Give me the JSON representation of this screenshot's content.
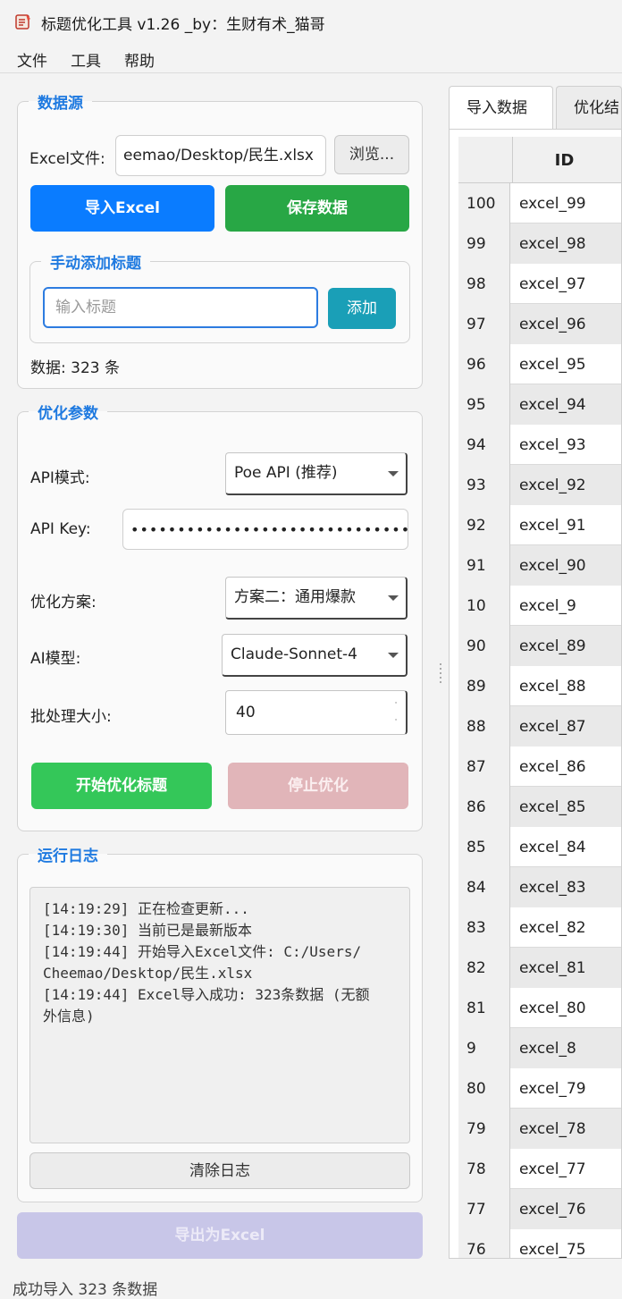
{
  "window": {
    "title": "标题优化工具 v1.26 _by：生财有术_猫哥"
  },
  "menu": {
    "items": [
      "文件",
      "工具",
      "帮助"
    ]
  },
  "data_source": {
    "legend": "数据源",
    "excel_label": "Excel文件:",
    "excel_path": "eemao/Desktop/民生.xlsx",
    "browse_label": "浏览...",
    "import_label": "导入Excel",
    "save_label": "保存数据",
    "manual_legend": "手动添加标题",
    "manual_placeholder": "输入标题",
    "add_label": "添加",
    "count_text": "数据: 323 条"
  },
  "params": {
    "legend": "优化参数",
    "api_mode_label": "API模式:",
    "api_mode_value": "Poe API (推荐)",
    "api_key_label": "API Key:",
    "api_key_value": "••••••••••••••••••••••••••••••",
    "plan_label": "优化方案:",
    "plan_value": "方案二：通用爆款",
    "model_label": "AI模型:",
    "model_value": "Claude-Sonnet-4",
    "batch_label": "批处理大小:",
    "batch_value": "40",
    "start_label": "开始优化标题",
    "stop_label": "停止优化"
  },
  "log": {
    "legend": "运行日志",
    "lines": [
      "[14:19:29] 正在检查更新...",
      "[14:19:30] 当前已是最新版本",
      "[14:19:44] 开始导入Excel文件: C:/Users/\nCheemao/Desktop/民生.xlsx",
      "[14:19:44] Excel导入成功: 323条数据 (无额\n外信息)"
    ],
    "clear_label": "清除日志"
  },
  "export_label": "导出为Excel",
  "status_text": "成功导入 323 条数据",
  "tabs": [
    "导入数据",
    "优化结"
  ],
  "table": {
    "header_id": "ID",
    "rows": [
      {
        "num": "100",
        "id": "excel_99"
      },
      {
        "num": "99",
        "id": "excel_98"
      },
      {
        "num": "98",
        "id": "excel_97"
      },
      {
        "num": "97",
        "id": "excel_96"
      },
      {
        "num": "96",
        "id": "excel_95"
      },
      {
        "num": "95",
        "id": "excel_94"
      },
      {
        "num": "94",
        "id": "excel_93"
      },
      {
        "num": "93",
        "id": "excel_92"
      },
      {
        "num": "92",
        "id": "excel_91"
      },
      {
        "num": "91",
        "id": "excel_90"
      },
      {
        "num": "10",
        "id": "excel_9"
      },
      {
        "num": "90",
        "id": "excel_89"
      },
      {
        "num": "89",
        "id": "excel_88"
      },
      {
        "num": "88",
        "id": "excel_87"
      },
      {
        "num": "87",
        "id": "excel_86"
      },
      {
        "num": "86",
        "id": "excel_85"
      },
      {
        "num": "85",
        "id": "excel_84"
      },
      {
        "num": "84",
        "id": "excel_83"
      },
      {
        "num": "83",
        "id": "excel_82"
      },
      {
        "num": "82",
        "id": "excel_81"
      },
      {
        "num": "81",
        "id": "excel_80"
      },
      {
        "num": "9",
        "id": "excel_8"
      },
      {
        "num": "80",
        "id": "excel_79"
      },
      {
        "num": "79",
        "id": "excel_78"
      },
      {
        "num": "78",
        "id": "excel_77"
      },
      {
        "num": "77",
        "id": "excel_76"
      },
      {
        "num": "76",
        "id": "excel_75"
      }
    ]
  },
  "colors": {
    "accent": "#1f7ae0",
    "import_button": "#0a7cff",
    "save_button": "#28a745",
    "add_button": "#1a9fb7",
    "start_button": "#34c759",
    "stop_button_disabled": "#e1b5b9",
    "export_button_disabled": "#c8c6e8"
  }
}
